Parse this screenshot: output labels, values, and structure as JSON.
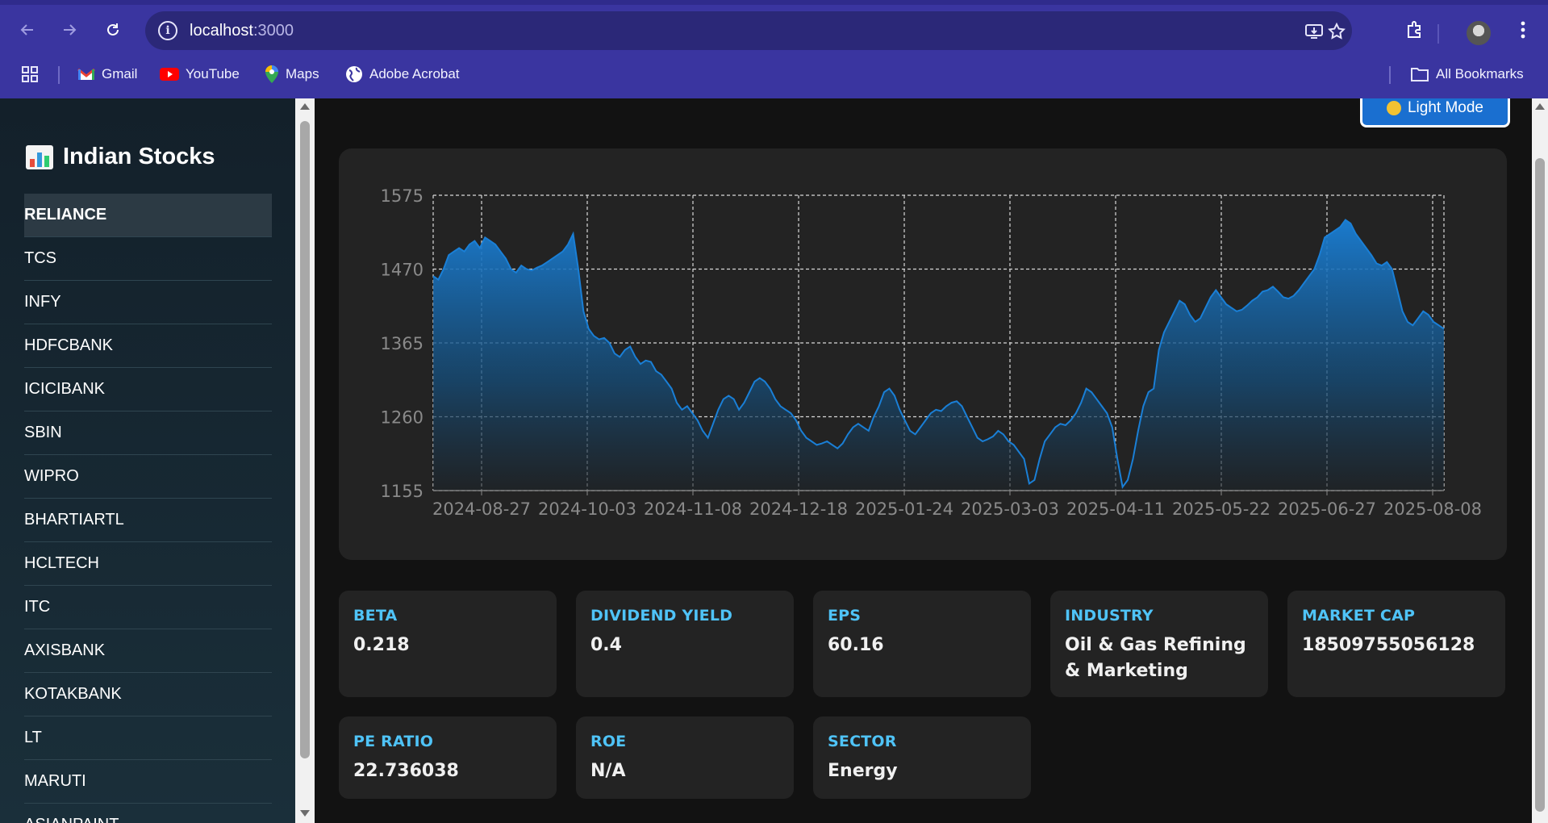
{
  "browser": {
    "url_host": "localhost",
    "url_port": ":3000",
    "bookmarks": [
      {
        "label": "Gmail",
        "icon": "gmail-icon"
      },
      {
        "label": "YouTube",
        "icon": "youtube-icon"
      },
      {
        "label": "Maps",
        "icon": "maps-icon"
      },
      {
        "label": "Adobe Acrobat",
        "icon": "globe-icon"
      }
    ],
    "all_bookmarks": "All Bookmarks"
  },
  "sidebar": {
    "title": "Indian Stocks",
    "items": [
      {
        "label": "RELIANCE",
        "active": true
      },
      {
        "label": "TCS"
      },
      {
        "label": "INFY"
      },
      {
        "label": "HDFCBANK"
      },
      {
        "label": "ICICIBANK"
      },
      {
        "label": "SBIN"
      },
      {
        "label": "WIPRO"
      },
      {
        "label": "BHARTIARTL"
      },
      {
        "label": "HCLTECH"
      },
      {
        "label": "ITC"
      },
      {
        "label": "AXISBANK"
      },
      {
        "label": "KOTAKBANK"
      },
      {
        "label": "LT"
      },
      {
        "label": "MARUTI"
      },
      {
        "label": "ASIANPAINT"
      }
    ]
  },
  "main": {
    "theme_button": "Light Mode"
  },
  "stats": [
    {
      "label": "BETA",
      "value": "0.218"
    },
    {
      "label": "DIVIDEND YIELD",
      "value": "0.4"
    },
    {
      "label": "EPS",
      "value": "60.16"
    },
    {
      "label": "INDUSTRY",
      "value": "Oil & Gas Refining & Marketing"
    },
    {
      "label": "MARKET CAP",
      "value": "18509755056128"
    },
    {
      "label": "PE RATIO",
      "value": "22.736038"
    },
    {
      "label": "ROE",
      "value": "N/A"
    },
    {
      "label": "SECTOR",
      "value": "Energy"
    }
  ],
  "colors": {
    "accent": "#4fc3f7",
    "chart_line": "#1a7fd6",
    "button": "#1a6fd0"
  },
  "chart_data": {
    "type": "area",
    "title": "",
    "xlabel": "",
    "ylabel": "",
    "ylim": [
      1155,
      1575
    ],
    "yticks": [
      1155,
      1260,
      1365,
      1470,
      1575
    ],
    "xticks": [
      "2024-08-27",
      "2024-10-03",
      "2024-11-08",
      "2024-12-18",
      "2025-01-24",
      "2025-03-03",
      "2025-04-11",
      "2025-05-22",
      "2025-06-27",
      "2025-08-08"
    ],
    "grid": true,
    "series": [
      {
        "name": "",
        "values": [
          1460,
          1455,
          1470,
          1490,
          1495,
          1500,
          1495,
          1505,
          1510,
          1500,
          1515,
          1510,
          1505,
          1495,
          1485,
          1470,
          1465,
          1475,
          1470,
          1468,
          1472,
          1475,
          1480,
          1485,
          1490,
          1495,
          1505,
          1520,
          1470,
          1410,
          1385,
          1375,
          1370,
          1372,
          1365,
          1350,
          1345,
          1355,
          1360,
          1345,
          1335,
          1340,
          1338,
          1325,
          1320,
          1310,
          1300,
          1280,
          1270,
          1275,
          1265,
          1255,
          1240,
          1230,
          1250,
          1270,
          1285,
          1290,
          1285,
          1270,
          1280,
          1295,
          1310,
          1315,
          1310,
          1300,
          1285,
          1275,
          1270,
          1265,
          1255,
          1240,
          1230,
          1225,
          1220,
          1222,
          1225,
          1220,
          1215,
          1222,
          1235,
          1245,
          1250,
          1245,
          1240,
          1260,
          1275,
          1295,
          1300,
          1290,
          1270,
          1255,
          1240,
          1235,
          1245,
          1255,
          1265,
          1270,
          1268,
          1275,
          1280,
          1282,
          1275,
          1260,
          1245,
          1230,
          1225,
          1228,
          1232,
          1240,
          1235,
          1225,
          1220,
          1210,
          1200,
          1165,
          1170,
          1200,
          1225,
          1235,
          1245,
          1250,
          1248,
          1255,
          1265,
          1280,
          1300,
          1295,
          1285,
          1275,
          1265,
          1245,
          1200,
          1160,
          1170,
          1200,
          1240,
          1275,
          1295,
          1300,
          1355,
          1380,
          1395,
          1410,
          1425,
          1420,
          1405,
          1395,
          1400,
          1415,
          1430,
          1440,
          1430,
          1420,
          1415,
          1410,
          1412,
          1418,
          1425,
          1430,
          1438,
          1440,
          1445,
          1438,
          1430,
          1428,
          1432,
          1440,
          1450,
          1460,
          1470,
          1490,
          1515,
          1520,
          1525,
          1530,
          1540,
          1535,
          1520,
          1510,
          1500,
          1490,
          1478,
          1475,
          1480,
          1470,
          1440,
          1410,
          1395,
          1390,
          1400,
          1410,
          1405,
          1395,
          1390,
          1385
        ]
      }
    ]
  }
}
